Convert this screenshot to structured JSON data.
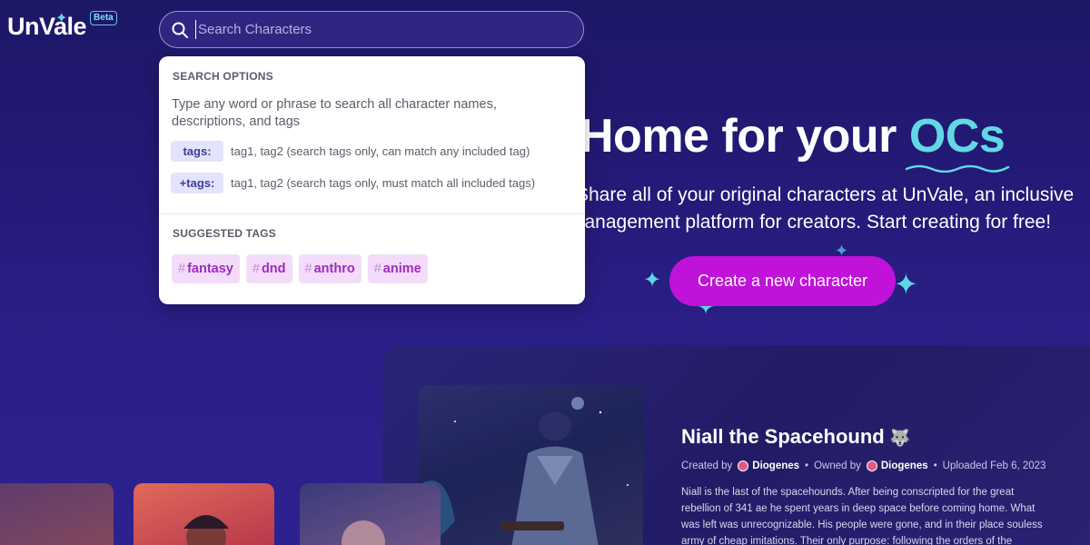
{
  "header": {
    "logo_text": "UnVale",
    "beta_label": "Beta",
    "search": {
      "placeholder": "Search Characters",
      "value": ""
    }
  },
  "search_dropdown": {
    "options_heading": "SEARCH OPTIONS",
    "description": "Type any word or phrase to search all character names, descriptions, and tags",
    "options": [
      {
        "label": "tags:",
        "text": "tag1, tag2 (search tags only, can match any included tag)"
      },
      {
        "label": "+tags:",
        "text": "tag1, tag2 (search tags only, must match all included tags)"
      }
    ],
    "suggested_heading": "SUGGESTED TAGS",
    "suggested_tags": [
      "fantasy",
      "dnd",
      "anthro",
      "anime"
    ]
  },
  "hero": {
    "title_main": "Home for your",
    "title_accent": "OCs",
    "subtitle_line1": "Share all of your original characters at UnVale, an inclusive",
    "subtitle_line2": "management platform for creators. Start creating for free!",
    "cta_label": "Create a new character"
  },
  "featured": {
    "title": "Niall the Spacehound",
    "title_emoji": "🐺",
    "created_by_label": "Created by",
    "creator": "Diogenes",
    "owned_by_label": "Owned by",
    "owner": "Diogenes",
    "uploaded": "Uploaded Feb 6, 2023",
    "description": "Niall is the last of the spacehounds. After being conscripted for the great rebellion of 341 ae he spent years in deep space before coming home. What was left was unrecognizable. His people were gone, and in their place souless army of cheap imitations. Their only purpose: following the orders of the federation. ✅ Now Niall"
  },
  "colors": {
    "background": "#221a72",
    "accent_cyan": "#62d8e4",
    "cta": "#c012d8",
    "tag_bg": "#f3dcf9",
    "tag_text": "#a02cc0"
  },
  "icons": [
    "search-icon",
    "sparkle-icon",
    "avatar-icon"
  ]
}
